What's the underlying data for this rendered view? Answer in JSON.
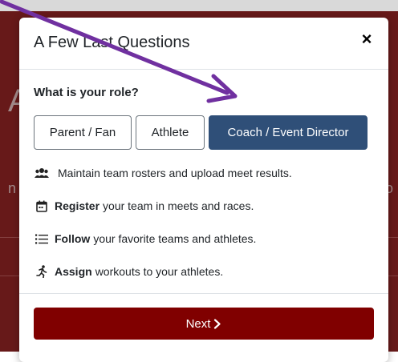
{
  "modal": {
    "title": "A Few Last Questions",
    "close_label": "×",
    "question": "What is your role?",
    "roles": [
      {
        "label": "Parent / Fan",
        "selected": false
      },
      {
        "label": "Athlete",
        "selected": false
      },
      {
        "label": "Coach / Event Director",
        "selected": true
      }
    ],
    "features": [
      {
        "icon": "users-icon",
        "bold": "",
        "text": "Maintain team rosters and upload meet results."
      },
      {
        "icon": "calendar-icon",
        "bold": "Register",
        "text": "your team in meets and races."
      },
      {
        "icon": "list-icon",
        "bold": "Follow",
        "text": "your favorite teams and athletes."
      },
      {
        "icon": "runner-icon",
        "bold": "Assign",
        "text": "workouts to your athletes."
      }
    ],
    "next_label": "Next"
  },
  "colors": {
    "accent_selected": "#2f4f78",
    "next_button": "#800000",
    "annotation_arrow": "#7030a0"
  }
}
